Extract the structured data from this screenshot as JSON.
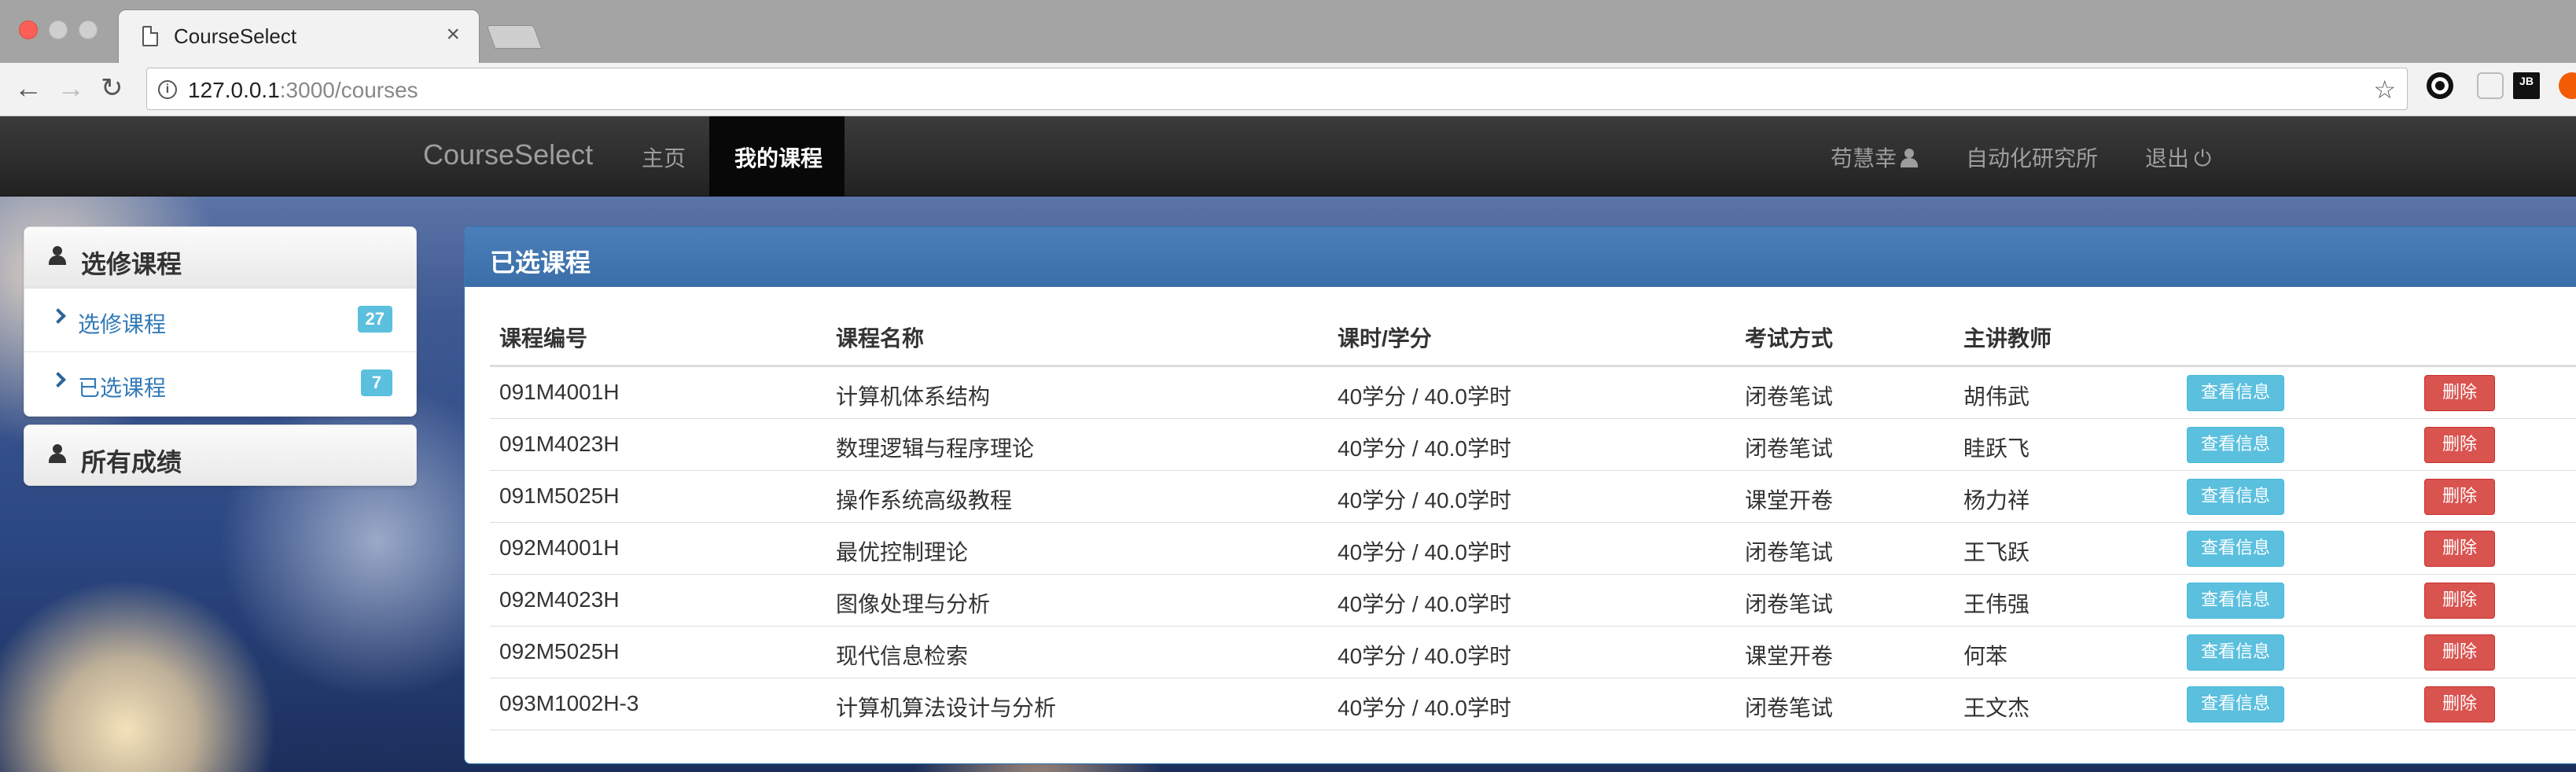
{
  "browser": {
    "tab_title": "CourseSelect",
    "tab_close": "×",
    "url_host": "127.0.0.1",
    "url_rest": ":3000/courses",
    "ext3_label": "JB"
  },
  "navbar": {
    "brand": "CourseSelect",
    "home": "主页",
    "my_courses": "我的课程",
    "user": "苟慧幸",
    "institute": "自动化研究所",
    "logout": "退出",
    "logout_glyph": "⏻"
  },
  "sidebar": {
    "panel1_title": "选修课程",
    "items": [
      {
        "label": "选修课程",
        "badge": "27"
      },
      {
        "label": "已选课程",
        "badge": "7"
      }
    ],
    "panel2_title": "所有成绩"
  },
  "main": {
    "title": "已选课程",
    "columns": [
      "课程编号",
      "课程名称",
      "课时/学分",
      "考试方式",
      "主讲教师"
    ],
    "view_label": "查看信息",
    "delete_label": "删除",
    "rows": [
      {
        "code": "091M4001H",
        "name": "计算机体系结构",
        "hours": "40学分 / 40.0学时",
        "exam": "闭卷笔试",
        "teacher": "胡伟武",
        "view": "查看信息",
        "del": "删除"
      },
      {
        "code": "091M4023H",
        "name": "数理逻辑与程序理论",
        "hours": "40学分 / 40.0学时",
        "exam": "闭卷笔试",
        "teacher": "眭跃飞",
        "view": "查看信息",
        "del": "删除"
      },
      {
        "code": "091M5025H",
        "name": "操作系统高级教程",
        "hours": "40学分 / 40.0学时",
        "exam": "课堂开卷",
        "teacher": "杨力祥",
        "view": "查看信息",
        "del": "删除"
      },
      {
        "code": "092M4001H",
        "name": "最优控制理论",
        "hours": "40学分 / 40.0学时",
        "exam": "闭卷笔试",
        "teacher": "王飞跃",
        "view": "查看信息",
        "del": "删除"
      },
      {
        "code": "092M4023H",
        "name": "图像处理与分析",
        "hours": "40学分 / 40.0学时",
        "exam": "闭卷笔试",
        "teacher": "王伟强",
        "view": "查看信息",
        "del": "删除"
      },
      {
        "code": "092M5025H",
        "name": "现代信息检索",
        "hours": "40学分 / 40.0学时",
        "exam": "课堂开卷",
        "teacher": "何苯",
        "view": "查看信息",
        "del": "删除"
      },
      {
        "code": "093M1002H-3",
        "name": "计算机算法设计与分析",
        "hours": "40学分 / 40.0学时",
        "exam": "闭卷笔试",
        "teacher": "王文杰",
        "view": "查看信息",
        "del": "删除"
      }
    ]
  },
  "colors": {
    "navbar": "#222222",
    "panel_primary": "#337ab7",
    "btn_info": "#5bc0de",
    "btn_danger": "#d9534f",
    "badge": "#5bc0de"
  }
}
